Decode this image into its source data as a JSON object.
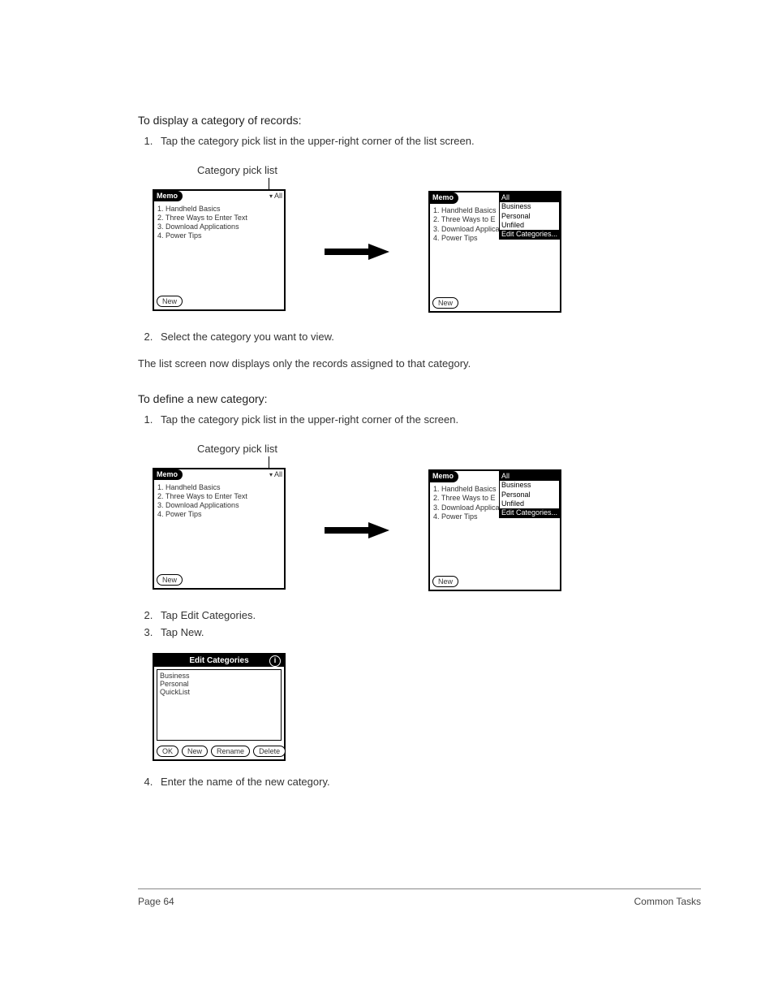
{
  "section1": {
    "heading": "To display a category of records:",
    "steps": [
      "Tap the category pick list in the upper-right corner of the list screen.",
      "Select the category you want to view."
    ],
    "result_text": "The list screen now displays only the records assigned to that category."
  },
  "section2": {
    "heading": "To define a new category:",
    "steps": [
      "Tap the category pick list in the upper-right corner of the screen.",
      "Tap Edit Categories.",
      "Tap New.",
      "Enter the name of the new category."
    ]
  },
  "callout_label": "Category pick list",
  "palm": {
    "app_title": "Memo",
    "current_category": "All",
    "new_button": "New",
    "memo_items": [
      "1. Handheld Basics",
      "2. Three Ways to Enter Text",
      "3. Download Applications",
      "4. Power Tips"
    ],
    "memo_items_truncated": [
      "1. Handheld Basics",
      "2. Three Ways to E",
      "3. Download Applica",
      "4. Power Tips"
    ],
    "dropdown_full": [
      "All",
      "Business",
      "Personal",
      "Unfiled",
      "Edit Categories..."
    ],
    "dropdown_short": [
      "All",
      "Business",
      "Personal",
      "Unfiled",
      "Edit Categories..."
    ]
  },
  "dialog": {
    "title": "Edit Categories",
    "items": [
      "Business",
      "Personal",
      "QuickList"
    ],
    "buttons": [
      "OK",
      "New",
      "Rename",
      "Delete"
    ]
  },
  "footer": {
    "left": "Page 64",
    "right": "Common Tasks"
  }
}
